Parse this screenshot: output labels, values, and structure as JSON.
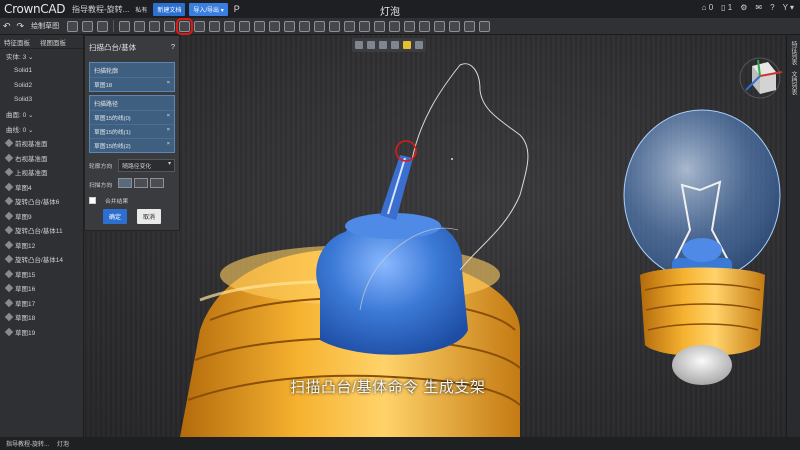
{
  "app": {
    "logo": "CrownCAD",
    "doc_title": "指导教程-旋转...",
    "tag": "私有",
    "new_doc": "新建文档",
    "import_export": "导入/导出 ▾",
    "p_label": "P",
    "window_title": "灯泡",
    "top_icons": [
      "⌂ 0",
      "▯ 1",
      "⚙",
      "✉",
      "?",
      "Y ▾"
    ]
  },
  "toolbar": {
    "sketch_label": "绘制草图",
    "icon_count": 23
  },
  "left_panel": {
    "tab_feature": "特征面板",
    "tab_view": "视图面板",
    "items": [
      "实体: 3 ⌄",
      "Solid1",
      "Solid2",
      "Solid3",
      "曲面: 0 ⌄",
      "曲线: 0 ⌄",
      "前视基准面",
      "右视基准面",
      "上视基准面",
      "草图4",
      "旋转凸台/基体6",
      "草图9",
      "旋转凸台/基体11",
      "草图12",
      "旋转凸台/基体14",
      "草图15",
      "草图16",
      "草图17",
      "草图18",
      "草图19"
    ]
  },
  "sweep_panel": {
    "title": "扫描凸台/基体",
    "help": "?",
    "profile_section": "扫描轮廓",
    "profile_value": "草图18",
    "path_section": "扫描路径",
    "path_items": [
      "草图15的线(0)",
      "草图15的线(1)",
      "草图15的线(2)"
    ],
    "orient_label": "轮廓方向",
    "orient_value": "随路径变化",
    "direction_label": "扫描方向",
    "merge_label": "合并结果",
    "ok": "确定",
    "cancel": "取消"
  },
  "right_strip": {
    "labels": [
      "特征列表",
      "文档列表"
    ]
  },
  "status": {
    "items": [
      "指导教程-旋转...",
      "灯泡"
    ]
  },
  "subtitle": "扫描凸台/基体命令 生成支架",
  "colors": {
    "bulb_blue": "#3b79d6",
    "base_orange": "#f2a126",
    "highlight_red": "#e01818",
    "accent_blue": "#2d6fd0"
  }
}
